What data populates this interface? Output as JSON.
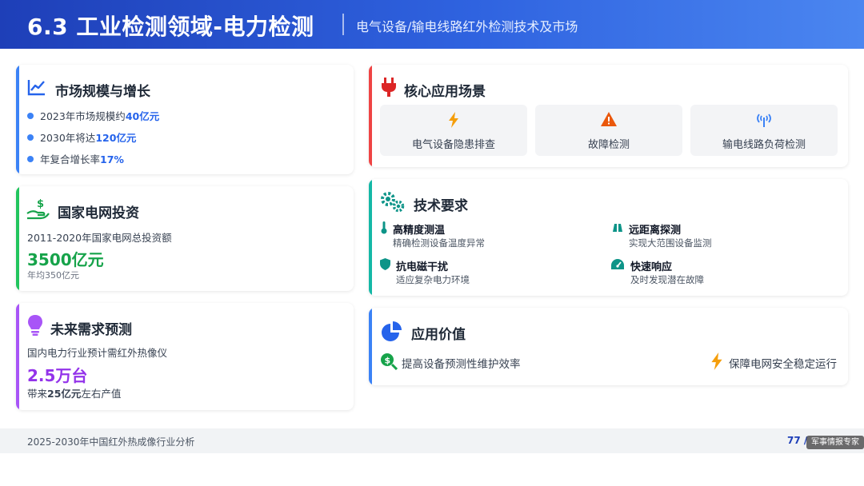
{
  "header": {
    "title": "6.3 工业检测领域-电力检测",
    "subtitle": "电气设备/输电线路红外检测技术及市场"
  },
  "market": {
    "title": "市场规模与增长",
    "icon": "line-chart-icon",
    "items": [
      {
        "prefix": "2023年市场规模约",
        "value": "40亿元"
      },
      {
        "prefix": "2030年将达",
        "value": "120亿元"
      },
      {
        "prefix": "年复合增长率",
        "value": "17%"
      }
    ]
  },
  "investment": {
    "title": "国家电网投资",
    "icon": "money-hand-icon",
    "line": "2011-2020年国家电网总投资额",
    "value": "3500亿元",
    "note": "年均350亿元"
  },
  "forecast": {
    "title": "未来需求预测",
    "icon": "lightbulb-icon",
    "line": "国内电力行业预计需红外热像仪",
    "value": "2.5万台",
    "tail_prefix": "带来",
    "tail_value": "25亿元",
    "tail_suffix": "左右产值"
  },
  "scenarios": {
    "title": "核心应用场景",
    "icon": "plug-icon",
    "items": [
      {
        "label": "电气设备隐患排查",
        "icon": "lightning-icon"
      },
      {
        "label": "故障检测",
        "icon": "warning-icon"
      },
      {
        "label": "输电线路负荷检测",
        "icon": "tower-signal-icon"
      }
    ]
  },
  "tech": {
    "title": "技术要求",
    "icon": "gears-icon",
    "items": [
      {
        "title": "高精度测温",
        "desc": "精确检测设备温度异常",
        "icon": "thermometer-icon"
      },
      {
        "title": "远距离探测",
        "desc": "实现大范围设备监测",
        "icon": "binoculars-icon"
      },
      {
        "title": "抗电磁干扰",
        "desc": "适应复杂电力环境",
        "icon": "shield-icon"
      },
      {
        "title": "快速响应",
        "desc": "及时发现潜在故障",
        "icon": "gauge-icon"
      }
    ]
  },
  "value": {
    "title": "应用价值",
    "icon": "pie-chart-icon",
    "items": [
      {
        "label": "提高设备预测性维护效率",
        "icon": "dollar-search-icon"
      },
      {
        "label": "保障电网安全稳定运行",
        "icon": "lightning-icon"
      }
    ]
  },
  "footer": {
    "left": "2025-2030年中国红外热成像行业分析",
    "page": "77 /",
    "watermark": "军事情报专家"
  },
  "colors": {
    "header": "#2f63e0",
    "blue": "#3b82f6",
    "green": "#22c55e",
    "purple": "#a855f7",
    "red": "#ef4444",
    "teal": "#14b8a6",
    "amber": "#f59e0b"
  }
}
